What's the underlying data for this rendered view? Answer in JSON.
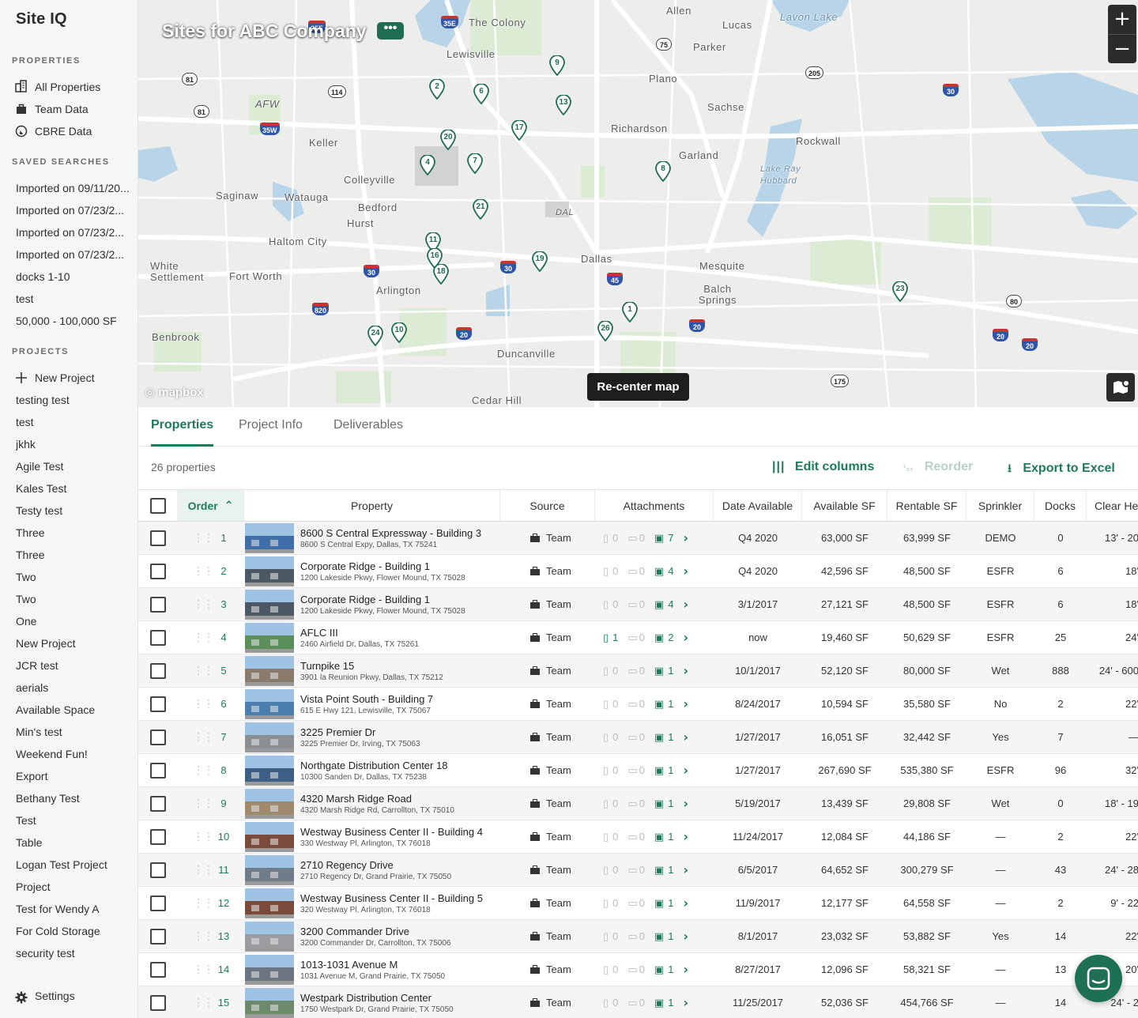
{
  "app": {
    "logo": "Site IQ"
  },
  "sidebar": {
    "properties_heading": "PROPERTIES",
    "properties": [
      {
        "label": "All Properties",
        "icon": "buildings-icon"
      },
      {
        "label": "Team Data",
        "icon": "briefcase-icon"
      },
      {
        "label": "CBRE Data",
        "icon": "globe-icon"
      }
    ],
    "saved_heading": "SAVED SEARCHES",
    "saved": [
      "Imported on 09/11/20...",
      "Imported on 07/23/2...",
      "Imported on 07/23/2...",
      "Imported on 07/23/2...",
      "docks 1-10",
      "test",
      "50,000 - 100,000 SF"
    ],
    "projects_heading": "PROJECTS",
    "new_project": "New Project",
    "projects": [
      "testing test",
      "test",
      "jkhk",
      "Agile Test",
      "Kales Test",
      "Testy test",
      "Three",
      "Three",
      "Two",
      "Two",
      "One",
      "New Project",
      "JCR test",
      "aerials",
      "Available Space",
      "Min's test",
      "Weekend Fun!",
      "Export",
      "Bethany Test",
      "Test",
      "Table",
      "Logan Test Project",
      "Project",
      "Test for Wendy A",
      "For Cold Storage",
      "security test"
    ],
    "settings": "Settings"
  },
  "map": {
    "title": "Sites for ABC Company",
    "menu": "•••",
    "zoom_in": "+",
    "zoom_out": "−",
    "recenter": "Re-center map",
    "attribution": "mapbox",
    "labels": [
      "Allen",
      "Lavon Lake",
      "The Colony",
      "Lucas",
      "Lewisville",
      "Parker",
      "Plano",
      "AFW",
      "Sachse",
      "Richardson",
      "Keller",
      "Rockwall",
      "Garland",
      "Colleyville",
      "Lake Ray Hubbard",
      "Saginaw",
      "Watauga",
      "Bedford",
      "DAL",
      "Hurst",
      "Haltom City",
      "White Settlement",
      "Fort Worth",
      "Dallas",
      "Mesquite",
      "Arlington",
      "Balch Springs",
      "Benbrook",
      "Duncanville",
      "Cedar Hill"
    ],
    "pins": [
      "9",
      "2",
      "6",
      "13",
      "17",
      "20",
      "4",
      "7",
      "8",
      "21",
      "11",
      "16",
      "18",
      "19",
      "23",
      "1",
      "24",
      "10",
      "26"
    ],
    "shields": [
      "35E",
      "35E",
      "75",
      "81",
      "114",
      "205",
      "30",
      "81",
      "35W",
      "30",
      "30",
      "45",
      "80",
      "820",
      "20",
      "20",
      "20",
      "20",
      "175"
    ]
  },
  "tabs": [
    "Properties",
    "Project Info",
    "Deliverables"
  ],
  "toolbar": {
    "count": "26 properties",
    "edit_columns": "Edit columns",
    "reorder": "Reorder",
    "export": "Export to Excel"
  },
  "table": {
    "columns": [
      "Order",
      "Property",
      "Source",
      "Attachments",
      "Date Available",
      "Available SF",
      "Rentable SF",
      "Sprinkler",
      "Docks",
      "Clear He"
    ],
    "rows": [
      {
        "order": "1",
        "name": "8600 S Central Expressway - Building 3",
        "address": "8600 S Central Expy, Dallas, TX 75241",
        "source": "Team",
        "docs": "0",
        "vids": "0",
        "imgs": "7",
        "date": "Q4 2020",
        "avail": "63,000 SF",
        "rent": "63,999 SF",
        "sprinkler": "DEMO",
        "docks": "0",
        "clear": "13' - 20",
        "color": "#3f6ea8"
      },
      {
        "order": "2",
        "name": "Corporate Ridge - Building 1",
        "address": "1200 Lakeside Pkwy, Flower Mound, TX 75028",
        "source": "Team",
        "docs": "0",
        "vids": "0",
        "imgs": "4",
        "date": "Q4 2020",
        "avail": "42,596 SF",
        "rent": "48,500 SF",
        "sprinkler": "ESFR",
        "docks": "6",
        "clear": "18'",
        "color": "#4c5863"
      },
      {
        "order": "3",
        "name": "Corporate Ridge - Building 1",
        "address": "1200 Lakeside Pkwy, Flower Mound, TX 75028",
        "source": "Team",
        "docs": "0",
        "vids": "0",
        "imgs": "4",
        "date": "3/1/2017",
        "avail": "27,121 SF",
        "rent": "48,500 SF",
        "sprinkler": "ESFR",
        "docks": "6",
        "clear": "18'",
        "color": "#4c5863"
      },
      {
        "order": "4",
        "name": "AFLC III",
        "address": "2460 Airfield Dr, Dallas, TX 75261",
        "source": "Team",
        "docs": "1",
        "vids": "0",
        "imgs": "2",
        "date": "now",
        "avail": "19,460 SF",
        "rent": "50,629 SF",
        "sprinkler": "ESFR",
        "docks": "25",
        "clear": "24'",
        "color": "#5b8f5a"
      },
      {
        "order": "5",
        "name": "Turnpike 15",
        "address": "3901 la Reunion Pkwy, Dallas, TX 75212",
        "source": "Team",
        "docs": "0",
        "vids": "0",
        "imgs": "1",
        "date": "10/1/2017",
        "avail": "52,120 SF",
        "rent": "80,000 SF",
        "sprinkler": "Wet",
        "docks": "888",
        "clear": "24' - 600",
        "color": "#8a7a6c"
      },
      {
        "order": "6",
        "name": "Vista Point South - Building 7",
        "address": "615 E Hwy 121, Lewisville, TX 75067",
        "source": "Team",
        "docs": "0",
        "vids": "0",
        "imgs": "1",
        "date": "8/24/2017",
        "avail": "10,594 SF",
        "rent": "35,580 SF",
        "sprinkler": "No",
        "docks": "2",
        "clear": "22'",
        "color": "#4a7fb0"
      },
      {
        "order": "7",
        "name": "3225 Premier Dr",
        "address": "3225 Premier Dr, Irving, TX 75063",
        "source": "Team",
        "docs": "0",
        "vids": "0",
        "imgs": "1",
        "date": "1/27/2017",
        "avail": "16,051 SF",
        "rent": "32,442 SF",
        "sprinkler": "Yes",
        "docks": "7",
        "clear": "—",
        "color": "#8a8f94"
      },
      {
        "order": "8",
        "name": "Northgate Distribution Center 18",
        "address": "10300 Sanden Dr, Dallas, TX 75238",
        "source": "Team",
        "docs": "0",
        "vids": "0",
        "imgs": "1",
        "date": "1/27/2017",
        "avail": "267,690 SF",
        "rent": "535,380 SF",
        "sprinkler": "ESFR",
        "docks": "96",
        "clear": "32'",
        "color": "#3d5f86"
      },
      {
        "order": "9",
        "name": "4320 Marsh Ridge Road",
        "address": "4320 Marsh Ridge Rd, Carrollton, TX 75010",
        "source": "Team",
        "docs": "0",
        "vids": "0",
        "imgs": "1",
        "date": "5/19/2017",
        "avail": "13,439 SF",
        "rent": "29,808 SF",
        "sprinkler": "Wet",
        "docks": "0",
        "clear": "18' - 19",
        "color": "#a08a6e"
      },
      {
        "order": "10",
        "name": "Westway Business Center II - Building 4",
        "address": "330 Westway Pl, Arlington, TX 76018",
        "source": "Team",
        "docs": "0",
        "vids": "0",
        "imgs": "1",
        "date": "11/24/2017",
        "avail": "12,084 SF",
        "rent": "44,186 SF",
        "sprinkler": "—",
        "docks": "2",
        "clear": "22'",
        "color": "#7a4b3a"
      },
      {
        "order": "11",
        "name": "2710 Regency Drive",
        "address": "2710 Regency Dr, Grand Prairie, TX 75050",
        "source": "Team",
        "docs": "0",
        "vids": "0",
        "imgs": "1",
        "date": "6/5/2017",
        "avail": "64,652 SF",
        "rent": "300,279 SF",
        "sprinkler": "—",
        "docks": "43",
        "clear": "24' - 28",
        "color": "#6f7c89"
      },
      {
        "order": "12",
        "name": "Westway Business Center II - Building 5",
        "address": "320 Westway Pl, Arlington, TX 76018",
        "source": "Team",
        "docs": "0",
        "vids": "0",
        "imgs": "1",
        "date": "11/9/2017",
        "avail": "12,177 SF",
        "rent": "64,558 SF",
        "sprinkler": "—",
        "docks": "2",
        "clear": "9' - 22",
        "color": "#7a4b3a"
      },
      {
        "order": "13",
        "name": "3200 Commander Drive",
        "address": "3200 Commander Dr, Carrollton, TX 75006",
        "source": "Team",
        "docs": "0",
        "vids": "0",
        "imgs": "1",
        "date": "8/1/2017",
        "avail": "23,032 SF",
        "rent": "53,882 SF",
        "sprinkler": "Yes",
        "docks": "14",
        "clear": "22'",
        "color": "#9a9ca0"
      },
      {
        "order": "14",
        "name": "1013-1031 Avenue M",
        "address": "1031 Avenue M, Grand Prairie, TX 75050",
        "source": "Team",
        "docs": "0",
        "vids": "0",
        "imgs": "1",
        "date": "8/27/2017",
        "avail": "12,096 SF",
        "rent": "58,321 SF",
        "sprinkler": "—",
        "docks": "13",
        "clear": "20'",
        "color": "#6b7682"
      },
      {
        "order": "15",
        "name": "Westpark Distribution Center",
        "address": "1750 Westpark Dr, Grand Prairie, TX 75050",
        "source": "Team",
        "docs": "0",
        "vids": "0",
        "imgs": "1",
        "date": "11/25/2017",
        "avail": "52,036 SF",
        "rent": "454,766 SF",
        "sprinkler": "—",
        "docks": "14",
        "clear": "24' - 2",
        "color": "#6d8a6a"
      }
    ]
  }
}
